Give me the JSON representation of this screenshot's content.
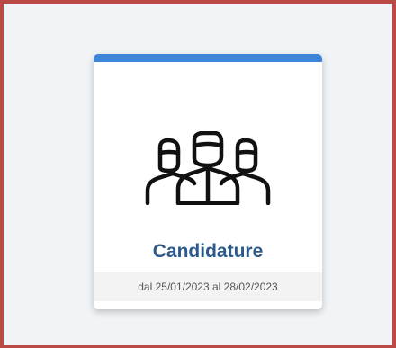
{
  "card": {
    "title": "Candidature",
    "date_range": "dal 25/01/2023 al 28/02/2023",
    "icon": "people-group-icon",
    "accent_color": "#3d85d8",
    "title_color": "#2b5a8a",
    "border_color": "#b94a45"
  }
}
